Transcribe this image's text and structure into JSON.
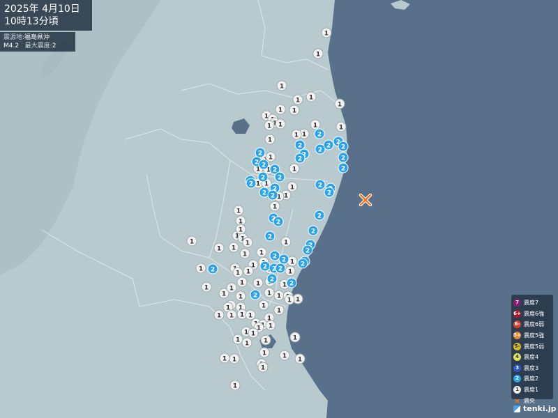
{
  "header": {
    "date": "2025年  4月10日",
    "time": "10時13分頃"
  },
  "quake": {
    "epicenter_label": "震源地:",
    "epicenter": "福島県沖",
    "magnitude": "M4.2",
    "max_label": "最大震度:",
    "max_intensity": "2"
  },
  "legend": [
    {
      "sym": "7",
      "label": "震度7",
      "color": "#8b1a6b"
    },
    {
      "sym": "6+",
      "label": "震度6強",
      "color": "#b0162a"
    },
    {
      "sym": "6-",
      "label": "震度6弱",
      "color": "#e03b2f"
    },
    {
      "sym": "5+",
      "label": "震度5強",
      "color": "#e8892e"
    },
    {
      "sym": "5-",
      "label": "震度5弱",
      "color": "#d8b92a"
    },
    {
      "sym": "4",
      "label": "震度4",
      "color": "#dde45a"
    },
    {
      "sym": "3",
      "label": "震度3",
      "color": "#2f56c7"
    },
    {
      "sym": "2",
      "label": "震度2",
      "color": "#2aa3e8"
    },
    {
      "sym": "1",
      "label": "震度1",
      "color": "#eeeeee"
    },
    {
      "sym": "×",
      "label": "震央",
      "color": "#e9772a"
    }
  ],
  "logo": "tenki.jp",
  "colors": {
    "sea": "#58708a",
    "land": "#b7c9cd",
    "int1": "#f2f2f2",
    "int2": "#2aa3e8",
    "epicenter": "#f07820"
  },
  "stations": {
    "ones": [
      [
        468,
        47
      ],
      [
        456,
        77
      ],
      [
        404,
        123
      ],
      [
        446,
        139
      ],
      [
        427,
        143
      ],
      [
        487,
        149
      ],
      [
        422,
        158
      ],
      [
        402,
        157
      ],
      [
        382,
        166
      ],
      [
        391,
        171
      ],
      [
        394,
        176
      ],
      [
        402,
        178
      ],
      [
        386,
        180
      ],
      [
        452,
        179
      ],
      [
        489,
        182
      ],
      [
        436,
        192
      ],
      [
        425,
        193
      ],
      [
        387,
        200
      ],
      [
        381,
        228
      ],
      [
        388,
        225
      ],
      [
        385,
        243
      ],
      [
        370,
        242
      ],
      [
        370,
        263
      ],
      [
        422,
        242
      ],
      [
        382,
        263
      ],
      [
        419,
        268
      ],
      [
        410,
        280
      ],
      [
        400,
        282
      ],
      [
        394,
        296
      ],
      [
        342,
        302
      ],
      [
        345,
        317
      ],
      [
        340,
        338
      ],
      [
        345,
        329
      ],
      [
        348,
        342
      ],
      [
        355,
        348
      ],
      [
        275,
        346
      ],
      [
        314,
        356
      ],
      [
        335,
        355
      ],
      [
        351,
        364
      ],
      [
        410,
        347
      ],
      [
        375,
        362
      ],
      [
        378,
        376
      ],
      [
        363,
        380
      ],
      [
        387,
        386
      ],
      [
        419,
        375
      ],
      [
        288,
        385
      ],
      [
        337,
        385
      ],
      [
        341,
        391
      ],
      [
        356,
        389
      ],
      [
        370,
        406
      ],
      [
        416,
        389
      ],
      [
        408,
        408
      ],
      [
        387,
        404
      ],
      [
        296,
        412
      ],
      [
        321,
        421
      ],
      [
        332,
        413
      ],
      [
        347,
        405
      ],
      [
        331,
        438
      ],
      [
        345,
        425
      ],
      [
        386,
        420
      ],
      [
        400,
        424
      ],
      [
        413,
        425
      ],
      [
        427,
        429
      ],
      [
        415,
        430
      ],
      [
        378,
        438
      ],
      [
        327,
        441
      ],
      [
        345,
        441
      ],
      [
        314,
        452
      ],
      [
        332,
        452
      ],
      [
        347,
        451
      ],
      [
        359,
        452
      ],
      [
        400,
        445
      ],
      [
        386,
        456
      ],
      [
        367,
        464
      ],
      [
        377,
        466
      ],
      [
        388,
        467
      ],
      [
        371,
        470
      ],
      [
        353,
        476
      ],
      [
        363,
        478
      ],
      [
        341,
        487
      ],
      [
        381,
        488
      ],
      [
        423,
        484
      ],
      [
        354,
        492
      ],
      [
        379,
        506
      ],
      [
        322,
        514
      ],
      [
        336,
        515
      ],
      [
        375,
        522
      ],
      [
        408,
        510
      ],
      [
        430,
        515
      ],
      [
        337,
        553
      ],
      [
        377,
        527
      ]
    ],
    "twos": [
      [
        458,
        192
      ],
      [
        430,
        208
      ],
      [
        459,
        214
      ],
      [
        471,
        208
      ],
      [
        485,
        203
      ],
      [
        492,
        210
      ],
      [
        373,
        219
      ],
      [
        368,
        232
      ],
      [
        436,
        221
      ],
      [
        430,
        227
      ],
      [
        492,
        226
      ],
      [
        378,
        236
      ],
      [
        492,
        241
      ],
      [
        394,
        243
      ],
      [
        401,
        254
      ],
      [
        377,
        254
      ],
      [
        359,
        259
      ],
      [
        360,
        263
      ],
      [
        394,
        270
      ],
      [
        379,
        276
      ],
      [
        391,
        280
      ],
      [
        459,
        265
      ],
      [
        474,
        270
      ],
      [
        472,
        276
      ],
      [
        392,
        313
      ],
      [
        399,
        318
      ],
      [
        458,
        309
      ],
      [
        387,
        339
      ],
      [
        449,
        331
      ],
      [
        445,
        351
      ],
      [
        441,
        359
      ],
      [
        437,
        375
      ],
      [
        434,
        378
      ],
      [
        305,
        386
      ],
      [
        394,
        367
      ],
      [
        407,
        372
      ],
      [
        380,
        382
      ],
      [
        393,
        385
      ],
      [
        402,
        385
      ],
      [
        390,
        400
      ],
      [
        418,
        406
      ],
      [
        366,
        423
      ]
    ],
    "epicenter": [
      524,
      287
    ]
  }
}
